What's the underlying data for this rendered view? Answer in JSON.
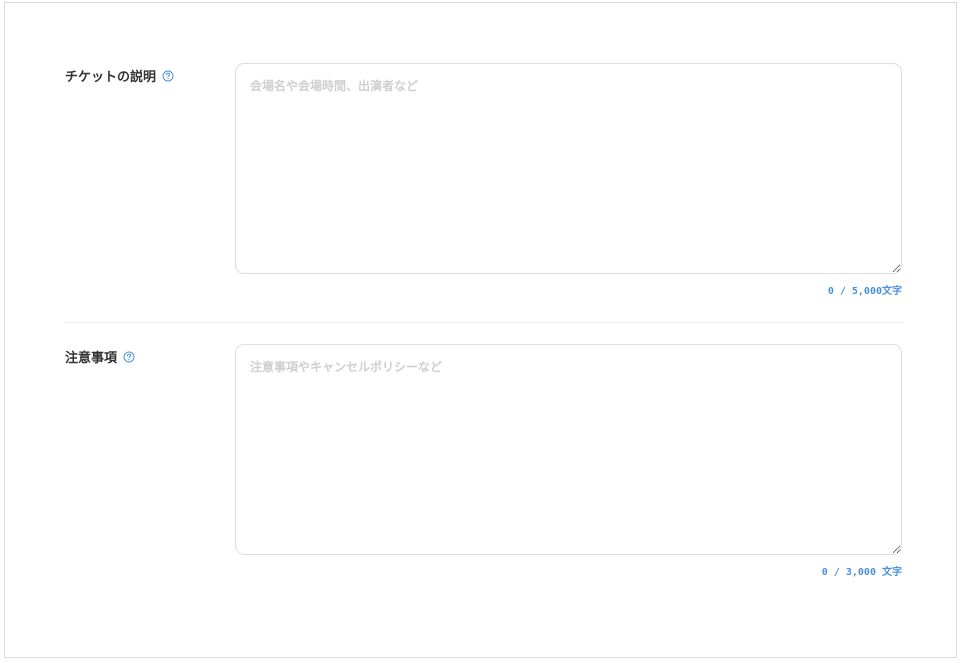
{
  "fields": [
    {
      "label": "チケットの説明",
      "placeholder": "会場名や会場時間、出演者など",
      "value": "",
      "counter": "0 / 5,000文字"
    },
    {
      "label": "注意事項",
      "placeholder": "注意事項やキャンセルポリシーなど",
      "value": "",
      "counter": "0 / 3,000 文字"
    }
  ],
  "icons": {
    "help": "question-circle-icon"
  },
  "colors": {
    "accent": "#4a8fe0",
    "label": "#333333",
    "placeholder": "#cfcfcf",
    "border": "#dedede"
  }
}
